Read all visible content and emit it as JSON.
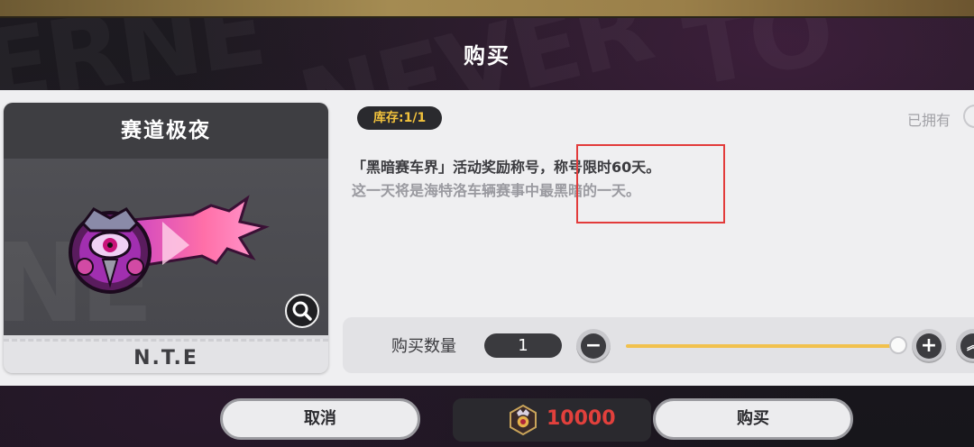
{
  "header": {
    "title": "购买"
  },
  "background_watermark": [
    "ERNE",
    "NEVER",
    "TO"
  ],
  "item": {
    "name": "赛道极夜",
    "brand": "N.T.E",
    "stock": "库存:1/1",
    "owned_label": "已拥有",
    "description_line1": "「黑暗赛车界」活动奖励称号，称号限时60天。",
    "description_line2": "这一天将是海特洛车辆赛事中最黑暗的一天。"
  },
  "quantity": {
    "label": "购买数量",
    "value": "1",
    "minus_symbol": "−",
    "plus_symbol": "+",
    "slider_fraction": 1.0
  },
  "footer": {
    "cancel_label": "取消",
    "buy_label": "购买",
    "price": "10000"
  },
  "colors": {
    "accent_gold": "#f2c23c",
    "price_red": "#e2403c",
    "highlight_red": "#e23b3b",
    "slider_yellow": "#f1c14d"
  },
  "icons": [
    "search-icon",
    "minus-icon",
    "plus-icon",
    "currency-badge-icon",
    "title-badge-icon"
  ]
}
